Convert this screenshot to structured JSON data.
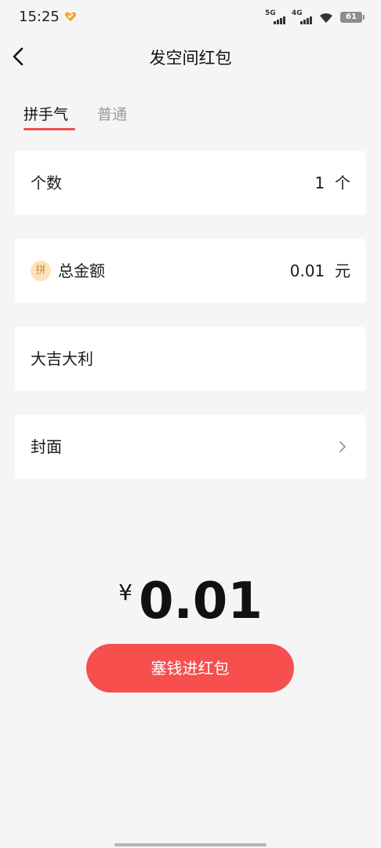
{
  "status_bar": {
    "time": "15:25",
    "network_1": "5G",
    "network_2": "4G",
    "battery": "61"
  },
  "header": {
    "title": "发空间红包",
    "back_icon": "chevron-left-icon"
  },
  "tabs": [
    {
      "label": "拼手气",
      "active": true
    },
    {
      "label": "普通",
      "active": false
    }
  ],
  "form": {
    "count": {
      "label": "个数",
      "value": "1",
      "unit": "个"
    },
    "total": {
      "badge": "拼",
      "label": "总金额",
      "value": "0.01",
      "unit": "元"
    },
    "message": {
      "value": "大吉大利"
    },
    "cover": {
      "label": "封面",
      "icon": "chevron-right-icon"
    }
  },
  "amount": {
    "currency": "¥",
    "value": "0.01"
  },
  "submit": {
    "label": "塞钱进红包"
  },
  "colors": {
    "accent": "#f74e4e",
    "tab_underline": "#f04e4e",
    "background": "#f5f5f5",
    "badge_bg": "#fbe2b9",
    "badge_text": "#d48a2c",
    "heart": "#f5a623"
  }
}
